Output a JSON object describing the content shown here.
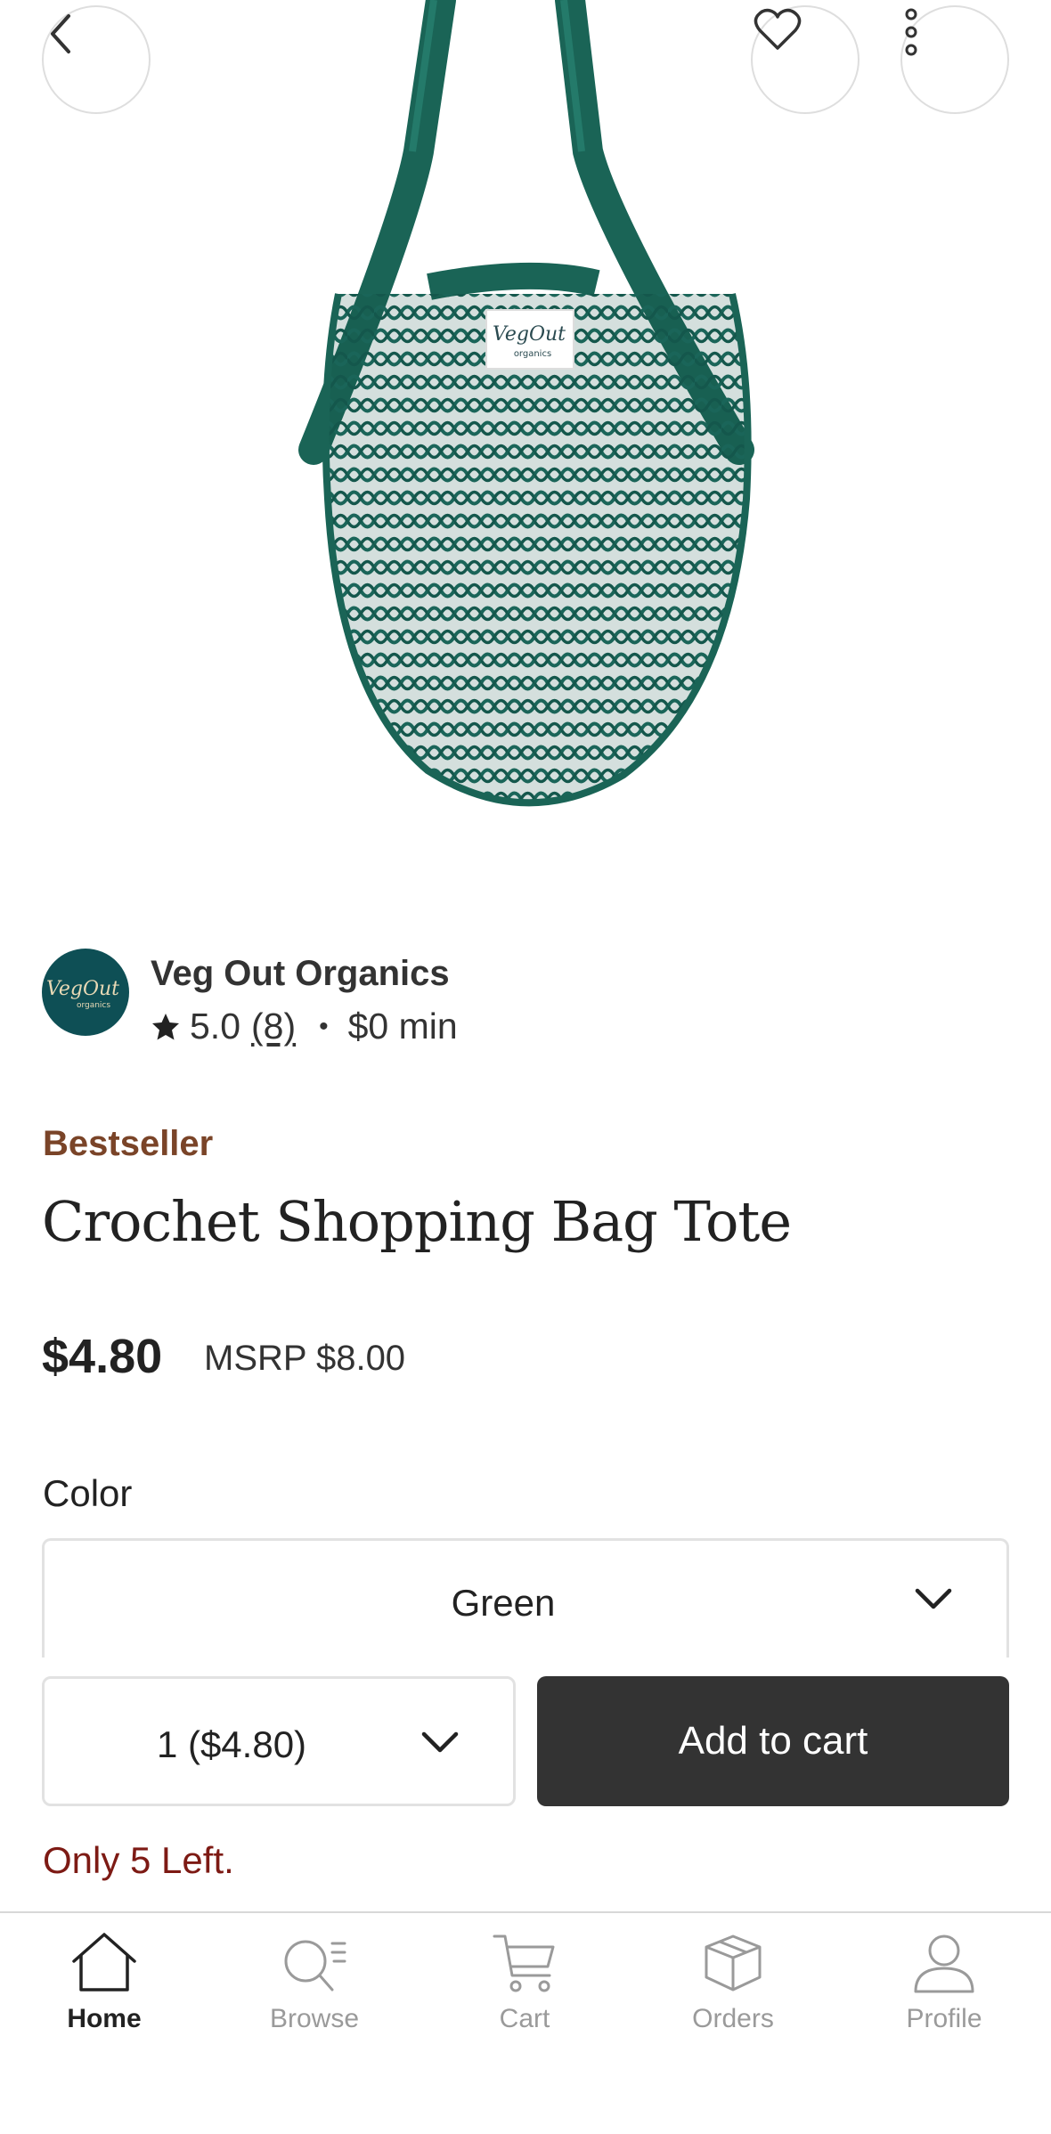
{
  "header": {
    "back_icon": "chevron-left-icon",
    "favorite_icon": "heart-icon",
    "more_icon": "vertical-dots-icon"
  },
  "product_image": {
    "tag_text": "VegOut",
    "tag_subtext": "organics",
    "bag_color": "#1d6b5e"
  },
  "shop": {
    "name": "Veg Out Organics",
    "logo_text": "VegOut",
    "logo_subtext": "organics",
    "rating": "5.0",
    "review_count": "(8)",
    "separator": "•",
    "minimum": "$0 min"
  },
  "product": {
    "badge": "Bestseller",
    "title": "Crochet Shopping Bag Tote",
    "price": "$4.80",
    "msrp": "MSRP $8.00"
  },
  "options": {
    "color_label": "Color",
    "color_value": "Green",
    "quantity_value": "1 ($4.80)"
  },
  "actions": {
    "add_to_cart": "Add to cart"
  },
  "stock_notice": "Only 5 Left.",
  "colors": {
    "accent_dark": "#333333",
    "badge": "#7a4428",
    "stock_warning": "#7d1a14",
    "shop_logo_bg": "#0e4f55"
  },
  "tabs": [
    {
      "label": "Home",
      "icon": "house-icon",
      "active": true
    },
    {
      "label": "Browse",
      "icon": "browse-search-icon",
      "active": false
    },
    {
      "label": "Cart",
      "icon": "shopping-cart-icon",
      "active": false
    },
    {
      "label": "Orders",
      "icon": "package-box-icon",
      "active": false
    },
    {
      "label": "Profile",
      "icon": "person-icon",
      "active": false
    }
  ]
}
